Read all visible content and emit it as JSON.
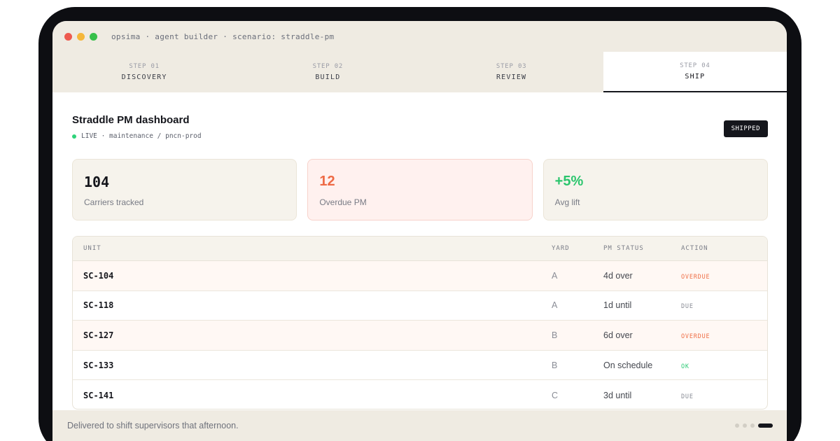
{
  "window": {
    "title": "opsima · agent builder · scenario: straddle-pm"
  },
  "steps": [
    {
      "number": "STEP 01",
      "label": "DISCOVERY",
      "active": false
    },
    {
      "number": "STEP 02",
      "label": "BUILD",
      "active": false
    },
    {
      "number": "STEP 03",
      "label": "REVIEW",
      "active": false
    },
    {
      "number": "STEP 04",
      "label": "SHIP",
      "active": true
    }
  ],
  "dashboard": {
    "title": "Straddle PM dashboard",
    "status": "LIVE · maintenance / pncn-prod",
    "badge": "SHIPPED"
  },
  "stats": [
    {
      "value": "104",
      "label": "Carriers tracked"
    },
    {
      "value": "12",
      "label": "Overdue PM"
    },
    {
      "value": "+5%",
      "label": "Avg lift"
    }
  ],
  "table": {
    "headers": {
      "unit": "UNIT",
      "yard": "YARD",
      "status": "PM STATUS",
      "action": "ACTION"
    },
    "rows": [
      {
        "unit": "SC-104",
        "yard": "A",
        "status": "4d over",
        "action": "OVERDUE"
      },
      {
        "unit": "SC-118",
        "yard": "A",
        "status": "1d until",
        "action": "DUE"
      },
      {
        "unit": "SC-127",
        "yard": "B",
        "status": "6d over",
        "action": "OVERDUE"
      },
      {
        "unit": "SC-133",
        "yard": "B",
        "status": "On schedule",
        "action": "OK"
      },
      {
        "unit": "SC-141",
        "yard": "C",
        "status": "3d until",
        "action": "DUE"
      }
    ]
  },
  "footer": {
    "caption": "Delivered to shift supervisors that afternoon.",
    "page_count": 4,
    "active_page": 4
  },
  "colors": {
    "accent_dark": "#15161c",
    "overdue": "#ef7048",
    "ok": "#2fcb77",
    "live": "#2fd37a",
    "chrome": "#efebe2"
  }
}
